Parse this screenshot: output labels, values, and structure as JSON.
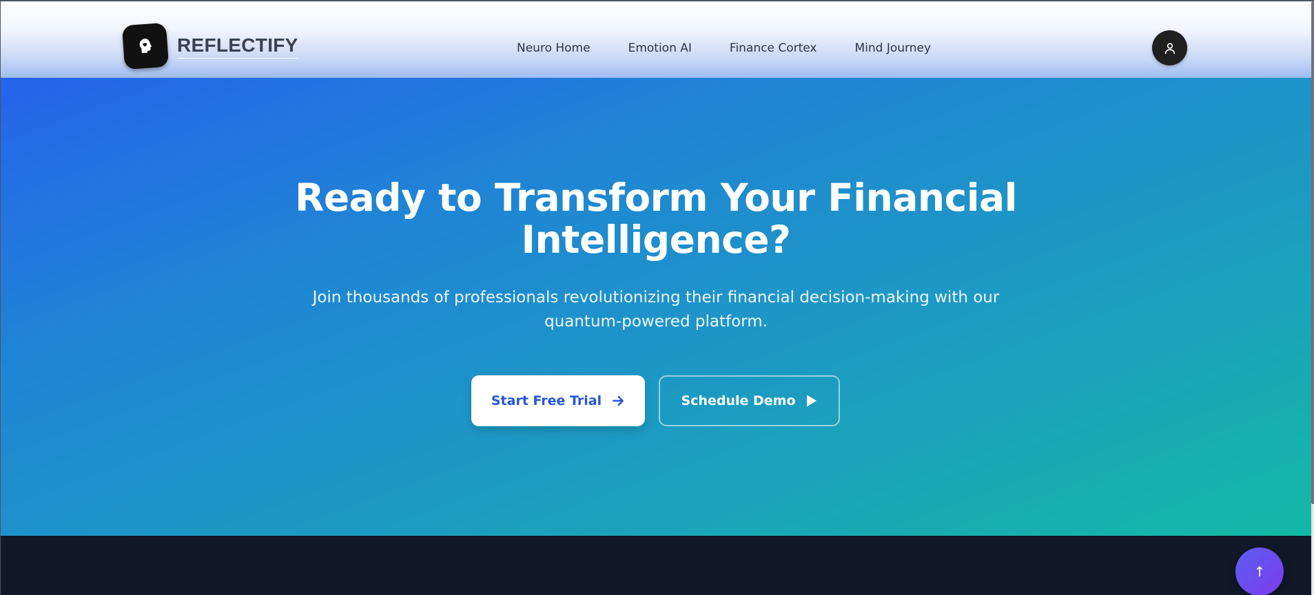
{
  "header": {
    "brand_name": "REFLECTIFY",
    "nav_items": [
      {
        "label": "Neuro Home"
      },
      {
        "label": "Emotion AI"
      },
      {
        "label": "Finance Cortex"
      },
      {
        "label": "Mind Journey"
      }
    ],
    "profile_icon": "user-icon",
    "logo_icon": "head-heart-icon"
  },
  "hero": {
    "title_line1": "Ready to Transform Your Financial",
    "title_line2": "Intelligence?",
    "subtitle_line1": "Join thousands of professionals revolutionizing their financial decision-making with our",
    "subtitle_line2": "quantum-powered platform.",
    "primary_button": {
      "label": "Start Free Trial",
      "icon": "arrow-right-icon"
    },
    "secondary_button": {
      "label": "Schedule Demo",
      "icon": "play-icon"
    }
  },
  "scroll_top": {
    "label": "↑"
  },
  "colors": {
    "hero_gradient_start": "#2563eb",
    "hero_gradient_end": "#14b8a6",
    "primary_button_text": "#2457d6",
    "footer_bg": "#111827",
    "scroll_top_bg": "#6d4aee"
  }
}
